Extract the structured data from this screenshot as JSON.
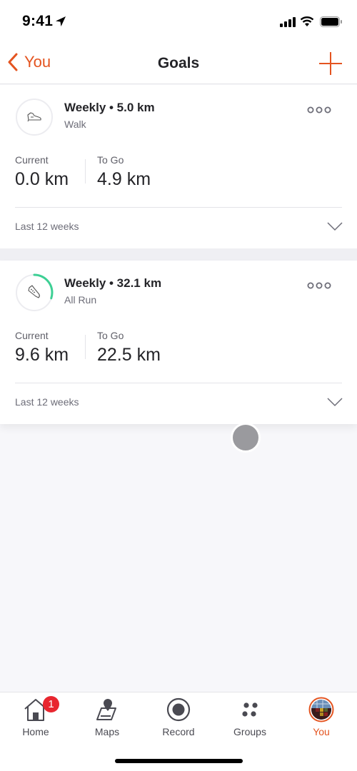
{
  "status_bar": {
    "time": "9:41"
  },
  "nav": {
    "back_label": "You",
    "title": "Goals"
  },
  "goals": [
    {
      "title": "Weekly • 5.0 km",
      "activity": "Walk",
      "activity_icon": "shoe-icon",
      "progress": 0.0,
      "current_label": "Current",
      "current_value": "0.0 km",
      "togo_label": "To Go",
      "togo_value": "4.9 km",
      "history_label": "Last 12 weeks"
    },
    {
      "title": "Weekly • 32.1 km",
      "activity": "All Run",
      "activity_icon": "running-shoe-icon",
      "progress": 0.3,
      "current_label": "Current",
      "current_value": "9.6 km",
      "togo_label": "To Go",
      "togo_value": "22.5 km",
      "history_label": "Last 12 weeks"
    }
  ],
  "tabs": [
    {
      "label": "Home",
      "icon": "home-icon",
      "badge": "1"
    },
    {
      "label": "Maps",
      "icon": "map-icon"
    },
    {
      "label": "Record",
      "icon": "record-icon"
    },
    {
      "label": "Groups",
      "icon": "groups-icon"
    },
    {
      "label": "You",
      "icon": "avatar",
      "active": true
    }
  ],
  "colors": {
    "accent": "#e45420",
    "progress": "#3dcf94",
    "badge": "#e8262f"
  }
}
